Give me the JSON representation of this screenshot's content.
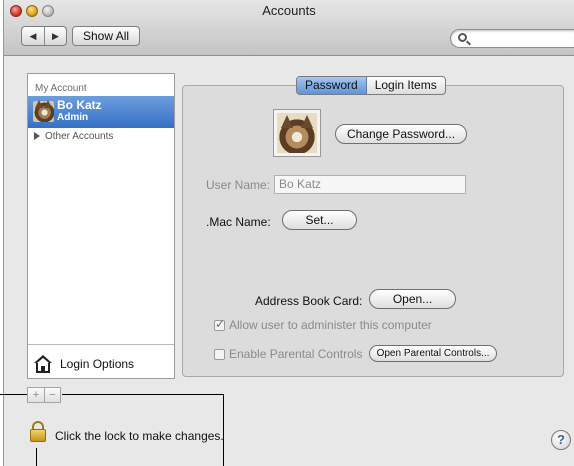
{
  "window": {
    "title": "Accounts"
  },
  "toolbar": {
    "back": "◀",
    "forward": "▶",
    "show_all": "Show All"
  },
  "search": {
    "value": ""
  },
  "sidebar": {
    "heading": "My Account",
    "current_user": {
      "name": "Bo Katz",
      "role": "Admin"
    },
    "other_accounts": "Other Accounts",
    "login_options": "Login Options"
  },
  "controls": {
    "plus": "+",
    "minus": "−"
  },
  "tabs": {
    "password": "Password",
    "login_items": "Login Items",
    "active": "Password"
  },
  "account": {
    "change_password": "Change Password...",
    "user_name_label": "User Name:",
    "user_name_value": "Bo Katz",
    "mac_name_label": ".Mac Name:",
    "set_button": "Set...",
    "address_book_label": "Address Book Card:",
    "open_button": "Open...",
    "allow_admin": {
      "label": "Allow user to administer this computer",
      "checked": true
    },
    "parental": {
      "label": "Enable Parental Controls",
      "checked": false
    },
    "open_parental": "Open Parental Controls..."
  },
  "lock": {
    "text": "Click the lock to make changes."
  },
  "help": "?"
}
